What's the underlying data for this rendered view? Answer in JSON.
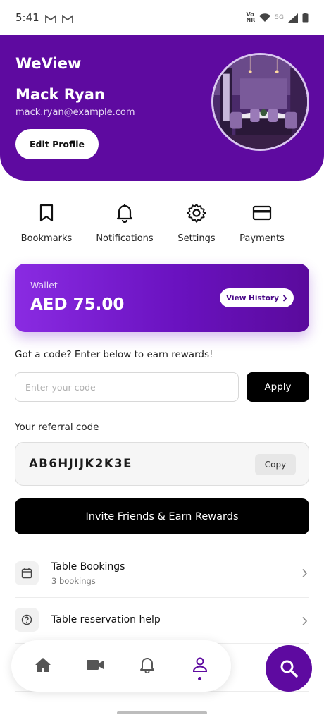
{
  "status_bar": {
    "time": "5:41",
    "network_label": "5G"
  },
  "header": {
    "brand": "WeView",
    "user_name": "Mack Ryan",
    "user_email": "mack.ryan@example.com",
    "edit_profile_label": "Edit Profile"
  },
  "quick_actions": [
    {
      "label": "Bookmarks",
      "icon": "bookmark-icon"
    },
    {
      "label": "Notifications",
      "icon": "bell-icon"
    },
    {
      "label": "Settings",
      "icon": "gear-icon"
    },
    {
      "label": "Payments",
      "icon": "card-icon"
    }
  ],
  "wallet": {
    "label": "Wallet",
    "amount": "AED 75.00",
    "history_label": "View History"
  },
  "code_entry": {
    "prompt": "Got a code? Enter below to earn rewards!",
    "placeholder": "Enter your code",
    "apply_label": "Apply"
  },
  "referral": {
    "label": "Your referral code",
    "code": "AB6HJIJK2K3E",
    "copy_label": "Copy"
  },
  "invite_label": "Invite Friends & Earn Rewards",
  "list": [
    {
      "title": "Table Bookings",
      "subtitle": "3 bookings",
      "icon": "calendar-icon"
    },
    {
      "title": "Table reservation help",
      "subtitle": "",
      "icon": "help-icon"
    }
  ],
  "bottom_nav": [
    {
      "name": "home",
      "icon": "home-icon",
      "active": false
    },
    {
      "name": "video",
      "icon": "video-icon",
      "active": false
    },
    {
      "name": "notifications",
      "icon": "bell-icon",
      "active": false
    },
    {
      "name": "profile",
      "icon": "profile-icon",
      "active": true
    }
  ],
  "colors": {
    "brand_purple": "#5e0aa0",
    "wallet_gradient_start": "#8a2be2",
    "black": "#000000"
  }
}
